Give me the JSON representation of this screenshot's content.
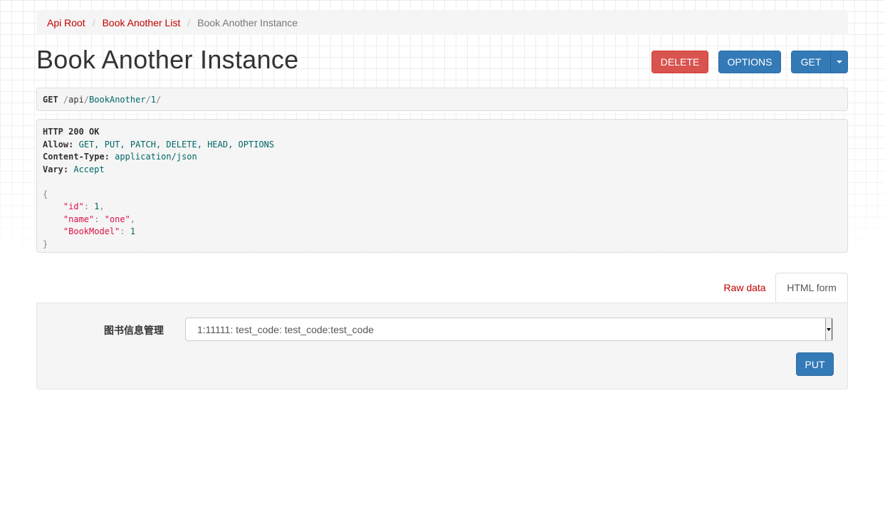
{
  "breadcrumb": {
    "root": "Api Root",
    "list": "Book Another List",
    "current": "Book Another Instance"
  },
  "page_title": "Book Another Instance",
  "actions": {
    "delete": "DELETE",
    "options": "OPTIONS",
    "get": "GET"
  },
  "request": {
    "method": "GET",
    "path_api": "api",
    "path_resource": "BookAnother",
    "path_id": "1"
  },
  "response": {
    "status": "HTTP 200 OK",
    "headers": [
      {
        "name": "Allow:",
        "value": "GET, PUT, PATCH, DELETE, HEAD, OPTIONS"
      },
      {
        "name": "Content-Type:",
        "value": "application/json"
      },
      {
        "name": "Vary:",
        "value": "Accept"
      }
    ],
    "body": [
      {
        "key": "\"id\"",
        "value": "1",
        "comma": ","
      },
      {
        "key": "\"name\"",
        "value": "\"one\"",
        "comma": ","
      },
      {
        "key": "\"BookModel\"",
        "value": "1",
        "comma": ""
      }
    ]
  },
  "tabs": {
    "raw": "Raw data",
    "html": "HTML form"
  },
  "form": {
    "label": "图书信息管理",
    "selected_value": "1:11111: test_code: test_code:test_code",
    "submit": "PUT"
  },
  "colors": {
    "link": "#c20000",
    "primary": "#337ab7",
    "danger": "#d9534f"
  }
}
